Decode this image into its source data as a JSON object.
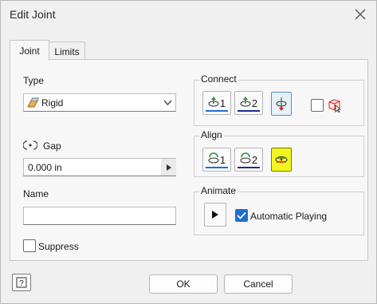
{
  "dialog": {
    "title": "Edit Joint"
  },
  "tabs": [
    {
      "label": "Joint",
      "active": true
    },
    {
      "label": "Limits",
      "active": false
    }
  ],
  "type": {
    "label": "Type",
    "value": "Rigid"
  },
  "gap": {
    "label": "Gap",
    "value": "0.000 in"
  },
  "name": {
    "label": "Name",
    "value": ""
  },
  "suppress": {
    "label": "Suppress",
    "checked": false
  },
  "connect": {
    "label": "Connect",
    "buttons": [
      "1",
      "2"
    ]
  },
  "align": {
    "label": "Align",
    "buttons": [
      "1",
      "2"
    ]
  },
  "animate": {
    "label": "Animate",
    "auto_label": "Automatic Playing",
    "auto_checked": true
  },
  "footer": {
    "ok": "OK",
    "cancel": "Cancel"
  },
  "colors": {
    "accent": "#1e6fd0",
    "highlight": "#f2f51f",
    "green": "#2e8b3a"
  }
}
